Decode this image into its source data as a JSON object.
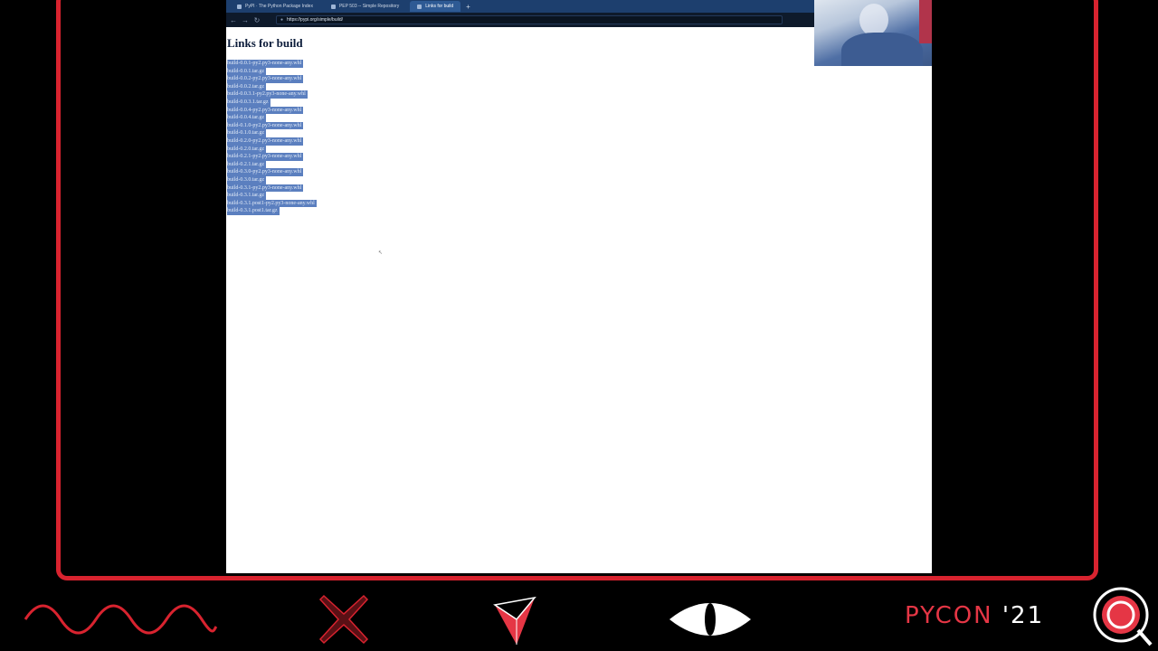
{
  "browser": {
    "tabs": [
      {
        "label": "PyPI · The Python Package Index",
        "active": false
      },
      {
        "label": "PEP 503 -- Simple Repository",
        "active": false
      },
      {
        "label": "Links for build",
        "active": true
      }
    ],
    "new_tab": "+",
    "nav": {
      "back": "←",
      "forward": "→",
      "reload": "↻"
    },
    "url": "https://pypi.org/simple/build/",
    "page_title": "Links for build",
    "links": [
      "build-0.0.1-py2.py3-none-any.whl",
      "build-0.0.1.tar.gz",
      "build-0.0.2-py2.py3-none-any.whl",
      "build-0.0.2.tar.gz",
      "build-0.0.3.1-py2.py3-none-any.whl",
      "build-0.0.3.1.tar.gz",
      "build-0.0.4-py2.py3-none-any.whl",
      "build-0.0.4.tar.gz",
      "build-0.1.0-py2.py3-none-any.whl",
      "build-0.1.0.tar.gz",
      "build-0.2.0-py2.py3-none-any.whl",
      "build-0.2.0.tar.gz",
      "build-0.2.1-py2.py3-none-any.whl",
      "build-0.2.1.tar.gz",
      "build-0.3.0-py2.py3-none-any.whl",
      "build-0.3.0.tar.gz",
      "build-0.3.1-py2.py3-none-any.whl",
      "build-0.3.1.tar.gz",
      "build-0.3.1.post1-py2.py3-none-any.whl",
      "build-0.3.1.post1.tar.gz"
    ]
  },
  "branding": {
    "logo_text": "PYCON",
    "logo_year": "'21",
    "accent_color": "#e53645",
    "frame_color": "#d8232f",
    "icons": [
      "wave-icon",
      "x-mark-icon",
      "triangle-icon",
      "eye-icon",
      "pycon-logo-icon"
    ]
  }
}
